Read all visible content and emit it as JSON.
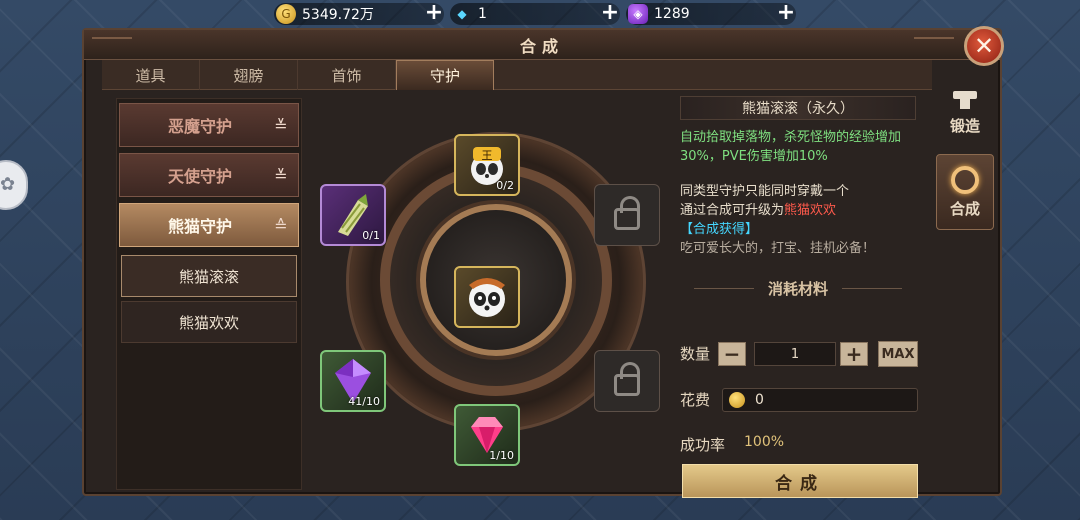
{
  "currencies": [
    {
      "icon": "gold-coin-icon",
      "value": "5349.72万"
    },
    {
      "icon": "diamond-icon",
      "value": "1"
    },
    {
      "icon": "purple-gem-icon",
      "value": "1289"
    }
  ],
  "window": {
    "title": "合成"
  },
  "tabs": [
    {
      "label": "道具",
      "active": false
    },
    {
      "label": "翅膀",
      "active": false
    },
    {
      "label": "首饰",
      "active": false
    },
    {
      "label": "守护",
      "active": true
    }
  ],
  "categories": [
    {
      "label": "恶魔守护",
      "expanded": false
    },
    {
      "label": "天使守护",
      "expanded": false
    },
    {
      "label": "熊猫守护",
      "expanded": true
    }
  ],
  "subitems": [
    {
      "label": "熊猫滚滚",
      "selected": true
    },
    {
      "label": "熊猫欢欢",
      "selected": false
    }
  ],
  "slots": {
    "top": {
      "icon": "panda-tiger-hat-icon",
      "count": "0/2"
    },
    "left_top": {
      "icon": "bamboo-shoot-icon",
      "count": "0/1"
    },
    "center": {
      "icon": "panda-guardian-icon",
      "count": ""
    },
    "left_bottom": {
      "icon": "purple-crystal-icon",
      "count": "41/10"
    },
    "bottom": {
      "icon": "pink-crystal-icon",
      "count": "1/10"
    }
  },
  "info": {
    "item_name": "熊猫滚滚（永久）",
    "desc_green": "自动拾取掉落物，杀死怪物的经验增加30%，PVE伤害增加10%",
    "desc_white_1": "同类型守护只能同时穿戴一个",
    "desc_white_2": "通过合成可升级为",
    "upgrade_target": "熊猫欢欢",
    "source": "【合成获得】",
    "flavor": "吃可爱长大的，打宝、挂机必备！",
    "section_title": "消耗材料",
    "qty_label": "数量",
    "qty_value": "1",
    "max_label": "MAX",
    "cost_label": "花费",
    "cost_value": "0",
    "rate_label": "成功率",
    "rate_value": "100%",
    "synth_button": "合成"
  },
  "side_nav": [
    {
      "label": "锻造",
      "icon": "anvil-icon",
      "active": false
    },
    {
      "label": "合成",
      "icon": "ring-icon",
      "active": true
    }
  ]
}
